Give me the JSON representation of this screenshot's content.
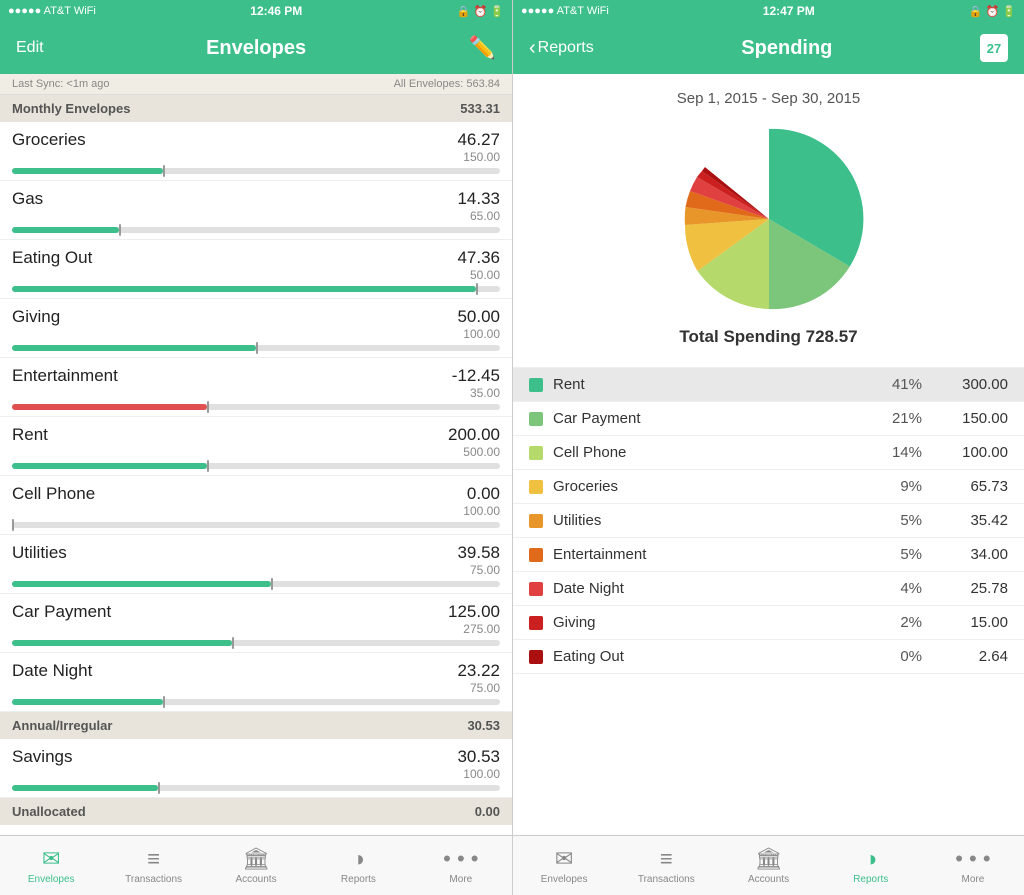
{
  "left": {
    "statusBar": {
      "left": "●●●●● AT&T  ⓦ",
      "center": "12:46 PM",
      "right": "🔒 ⏰ 🔋"
    },
    "navTitle": "Envelopes",
    "editBtn": "Edit",
    "syncText": "Last Sync: <1m ago",
    "allEnvelopesLabel": "All Envelopes:",
    "allEnvelopesValue": "563.84",
    "monthlySection": {
      "label": "Monthly Envelopes",
      "value": "533.31"
    },
    "envelopes": [
      {
        "name": "Groceries",
        "spent": "46.27",
        "budget": "150.00",
        "pct": 31,
        "negative": false
      },
      {
        "name": "Gas",
        "spent": "14.33",
        "budget": "65.00",
        "pct": 22,
        "negative": false
      },
      {
        "name": "Eating Out",
        "spent": "47.36",
        "budget": "50.00",
        "pct": 95,
        "negative": false
      },
      {
        "name": "Giving",
        "spent": "50.00",
        "budget": "100.00",
        "pct": 50,
        "negative": false
      },
      {
        "name": "Entertainment",
        "spent": "-12.45",
        "budget": "35.00",
        "pct": 30,
        "negative": true
      },
      {
        "name": "Rent",
        "spent": "200.00",
        "budget": "500.00",
        "pct": 40,
        "negative": false
      },
      {
        "name": "Cell Phone",
        "spent": "0.00",
        "budget": "100.00",
        "pct": 0,
        "negative": false
      },
      {
        "name": "Utilities",
        "spent": "39.58",
        "budget": "75.00",
        "pct": 53,
        "negative": false
      },
      {
        "name": "Car Payment",
        "spent": "125.00",
        "budget": "275.00",
        "pct": 45,
        "negative": false
      },
      {
        "name": "Date Night",
        "spent": "23.22",
        "budget": "75.00",
        "pct": 31,
        "negative": false
      }
    ],
    "annualSection": {
      "label": "Annual/Irregular",
      "value": "30.53"
    },
    "annualEnvelopes": [
      {
        "name": "Savings",
        "spent": "30.53",
        "budget": "100.00",
        "pct": 30,
        "negative": false
      }
    ],
    "unallocatedLabel": "Unallocated",
    "unallocatedValue": "0.00",
    "tabs": [
      {
        "id": "envelopes",
        "label": "Envelopes",
        "active": true
      },
      {
        "id": "transactions",
        "label": "Transactions",
        "active": false
      },
      {
        "id": "accounts",
        "label": "Accounts",
        "active": false
      },
      {
        "id": "reports",
        "label": "Reports",
        "active": false
      },
      {
        "id": "more",
        "label": "More",
        "active": false
      }
    ]
  },
  "right": {
    "statusBar": {
      "left": "●●●●● AT&T  ⓦ",
      "center": "12:47 PM",
      "right": "🔒 ⏰ 🔋"
    },
    "backLabel": "Reports",
    "navTitle": "Spending",
    "dateRange": "Sep 1, 2015 - Sep 30, 2015",
    "totalLabel": "Total Spending",
    "totalValue": "728.57",
    "chart": {
      "segments": [
        {
          "name": "Rent",
          "pct": 41,
          "color": "#3dbf8c",
          "startAngle": 0,
          "sweepAngle": 148
        },
        {
          "name": "Car Payment",
          "pct": 21,
          "color": "#7bc67a",
          "startAngle": 148,
          "sweepAngle": 76
        },
        {
          "name": "Cell Phone",
          "pct": 14,
          "color": "#b5d96b",
          "startAngle": 224,
          "sweepAngle": 50
        },
        {
          "name": "Groceries",
          "pct": 9,
          "color": "#f0c040",
          "startAngle": 274,
          "sweepAngle": 32
        },
        {
          "name": "Utilities",
          "pct": 5,
          "color": "#e8962a",
          "startAngle": 306,
          "sweepAngle": 18
        },
        {
          "name": "Entertainment",
          "pct": 5,
          "color": "#e06a1a",
          "startAngle": 324,
          "sweepAngle": 18
        },
        {
          "name": "Date Night",
          "pct": 4,
          "color": "#e04040",
          "startAngle": 342,
          "sweepAngle": 14
        },
        {
          "name": "Giving",
          "pct": 2,
          "color": "#cc2020",
          "startAngle": 356,
          "sweepAngle": 7
        },
        {
          "name": "Eating Out",
          "pct": 0,
          "color": "#aa1010",
          "startAngle": 363,
          "sweepAngle": 2
        }
      ]
    },
    "legend": [
      {
        "name": "Rent",
        "pct": "41%",
        "value": "300.00",
        "color": "#3dbf8c",
        "highlighted": true
      },
      {
        "name": "Car Payment",
        "pct": "21%",
        "value": "150.00",
        "color": "#7bc67a",
        "highlighted": false
      },
      {
        "name": "Cell Phone",
        "pct": "14%",
        "value": "100.00",
        "color": "#b5d96b",
        "highlighted": false
      },
      {
        "name": "Groceries",
        "pct": "9%",
        "value": "65.73",
        "color": "#f0c040",
        "highlighted": false
      },
      {
        "name": "Utilities",
        "pct": "5%",
        "value": "35.42",
        "color": "#e8962a",
        "highlighted": false
      },
      {
        "name": "Entertainment",
        "pct": "5%",
        "value": "34.00",
        "color": "#e06a1a",
        "highlighted": false
      },
      {
        "name": "Date Night",
        "pct": "4%",
        "value": "25.78",
        "color": "#e04040",
        "highlighted": false
      },
      {
        "name": "Giving",
        "pct": "2%",
        "value": "15.00",
        "color": "#cc2020",
        "highlighted": false
      },
      {
        "name": "Eating Out",
        "pct": "0%",
        "value": "2.64",
        "color": "#aa1010",
        "highlighted": false
      }
    ],
    "tabs": [
      {
        "id": "envelopes",
        "label": "Envelopes",
        "active": false
      },
      {
        "id": "transactions",
        "label": "Transactions",
        "active": false
      },
      {
        "id": "accounts",
        "label": "Accounts",
        "active": false
      },
      {
        "id": "reports",
        "label": "Reports",
        "active": true
      },
      {
        "id": "more",
        "label": "More",
        "active": false
      }
    ]
  }
}
